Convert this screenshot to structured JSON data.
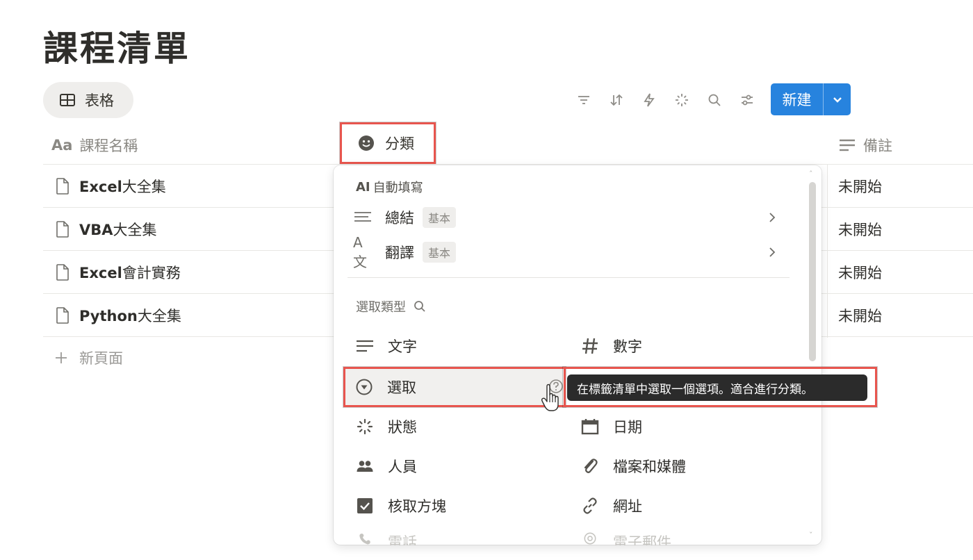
{
  "page": {
    "title": "課程清單"
  },
  "view": {
    "tab_label": "表格"
  },
  "toolbar": {
    "icons": [
      "filter-icon",
      "sort-icon",
      "automation-icon",
      "ai-sparkle-icon",
      "search-icon",
      "settings-icon"
    ],
    "new_label": "新建"
  },
  "table": {
    "columns": {
      "name_prefix": "Aa",
      "name": "課程名稱",
      "category": "分類",
      "note": "備註"
    },
    "rows": [
      {
        "latin": "Excel",
        "cjk": "大全集",
        "note": "未開始"
      },
      {
        "latin": "VBA",
        "cjk": "大全集",
        "note": "未開始"
      },
      {
        "latin": "Excel",
        "cjk": "會計實務",
        "note": "未開始"
      },
      {
        "latin": "Python",
        "cjk": "大全集",
        "note": "未開始"
      }
    ],
    "new_page_label": "新頁面"
  },
  "menu": {
    "ai_section": {
      "prefix": "AI",
      "title": "自動填寫"
    },
    "ai_items": [
      {
        "label": "總結",
        "badge": "基本"
      },
      {
        "label": "翻譯",
        "badge": "基本",
        "icon_text": "A文"
      }
    ],
    "types_section_title": "選取類型",
    "types": {
      "text": "文字",
      "number": "數字",
      "select": "選取",
      "status": "狀態",
      "date": "日期",
      "person": "人員",
      "files": "檔案和媒體",
      "checkbox": "核取方塊",
      "url": "網址",
      "phone": "電話",
      "email": "電子郵件"
    },
    "tooltip": "在標籤清單中選取一個選項。適合進行分類。"
  },
  "colors": {
    "accent": "#2783de",
    "highlight": "#e8554e",
    "tooltip_bg": "#2b2b2b"
  }
}
